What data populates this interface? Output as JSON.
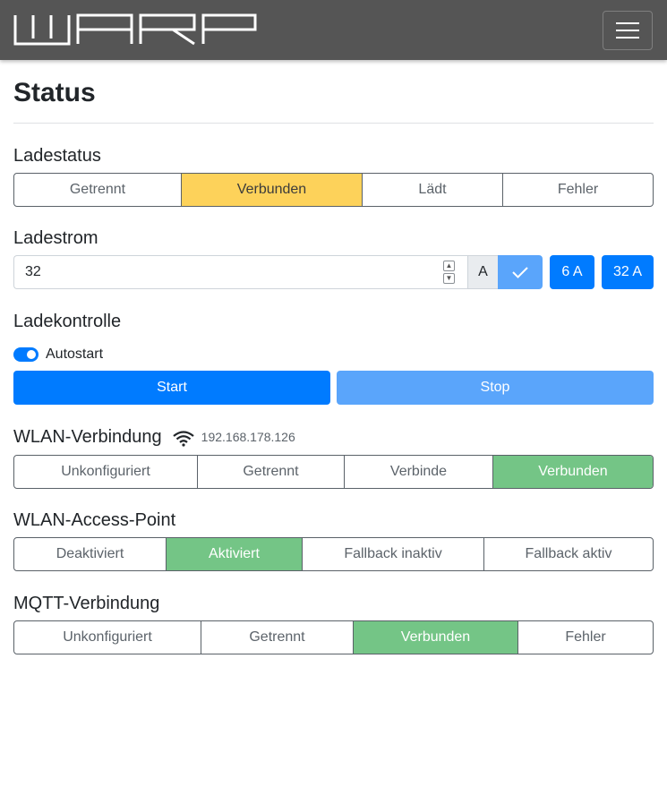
{
  "navbar": {
    "logo_text": "WARP",
    "menu_icon": "hamburger-menu-icon"
  },
  "page": {
    "title": "Status"
  },
  "ladestatus": {
    "title": "Ladestatus",
    "options": [
      "Getrennt",
      "Verbunden",
      "Lädt",
      "Fehler"
    ],
    "active": "Verbunden"
  },
  "ladestrom": {
    "title": "Ladestrom",
    "value": "32",
    "unit": "A",
    "confirm_icon": "check-icon",
    "presets": [
      "6 A",
      "32 A"
    ]
  },
  "ladekontrolle": {
    "title": "Ladekontrolle",
    "autostart_label": "Autostart",
    "autostart_enabled": true,
    "start_label": "Start",
    "stop_label": "Stop"
  },
  "wlan": {
    "title": "WLAN-Verbindung",
    "icon": "wifi-icon",
    "ip": "192.168.178.126",
    "options": [
      "Unkonfiguriert",
      "Getrennt",
      "Verbinde",
      "Verbunden"
    ],
    "active": "Verbunden"
  },
  "ap": {
    "title": "WLAN-Access-Point",
    "options": [
      "Deaktiviert",
      "Aktiviert",
      "Fallback inaktiv",
      "Fallback aktiv"
    ],
    "active": "Aktiviert"
  },
  "mqtt": {
    "title": "MQTT-Verbindung",
    "options": [
      "Unkonfiguriert",
      "Getrennt",
      "Verbunden",
      "Fehler"
    ],
    "active": "Verbunden"
  },
  "colors": {
    "navbar": "#555555",
    "primary": "#007bff",
    "primary_light": "#5aa5fb",
    "warning": "#fdd25a",
    "success": "#74c586"
  }
}
